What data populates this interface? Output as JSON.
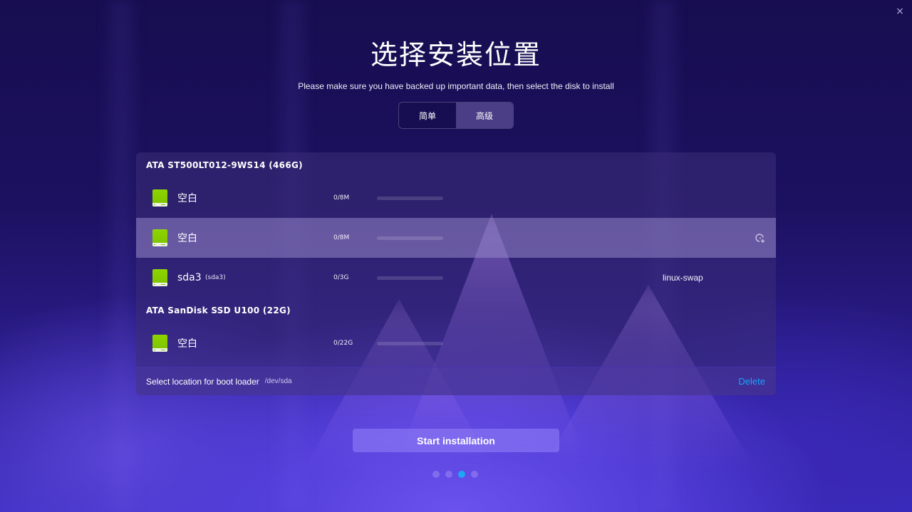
{
  "window": {
    "close_icon": "×"
  },
  "header": {
    "title": "选择安装位置",
    "subtitle": "Please make sure you have backed up important data, then select the disk to install"
  },
  "mode_switch": {
    "options": [
      {
        "label": "简单",
        "active": false
      },
      {
        "label": "高级",
        "active": true
      }
    ]
  },
  "disks": [
    {
      "name": "ATA ST500LT012-9WS14 (466G)",
      "partitions": [
        {
          "name": "空白",
          "sub": "",
          "size": "0/8M",
          "usage": 0,
          "filesystem": "",
          "selected": false,
          "icon": "green-drive-icon"
        },
        {
          "name": "空白",
          "sub": "",
          "size": "0/8M",
          "usage": 0,
          "filesystem": "",
          "selected": true,
          "icon": "green-drive-icon",
          "action_icon": "new-partition-icon"
        },
        {
          "name": "sda3",
          "sub": "(sda3)",
          "size": "0/3G",
          "usage": 0,
          "filesystem": "linux-swap",
          "selected": false,
          "icon": "green-drive-icon"
        }
      ]
    },
    {
      "name": "ATA SanDisk SSD U100 (22G)",
      "partitions": [
        {
          "name": "空白",
          "sub": "",
          "size": "0/22G",
          "usage": 0,
          "filesystem": "",
          "selected": false,
          "icon": "green-drive-icon"
        }
      ]
    }
  ],
  "bootloader": {
    "label": "Select location for boot loader",
    "value": "/dev/sda"
  },
  "actions": {
    "delete_label": "Delete",
    "start_label": "Start installation"
  },
  "pagination": {
    "total": 4,
    "current": 3
  },
  "colors": {
    "accent": "#1aa3ff",
    "active_dot": "#1ea6f5",
    "drive_green": "#8ed400"
  }
}
